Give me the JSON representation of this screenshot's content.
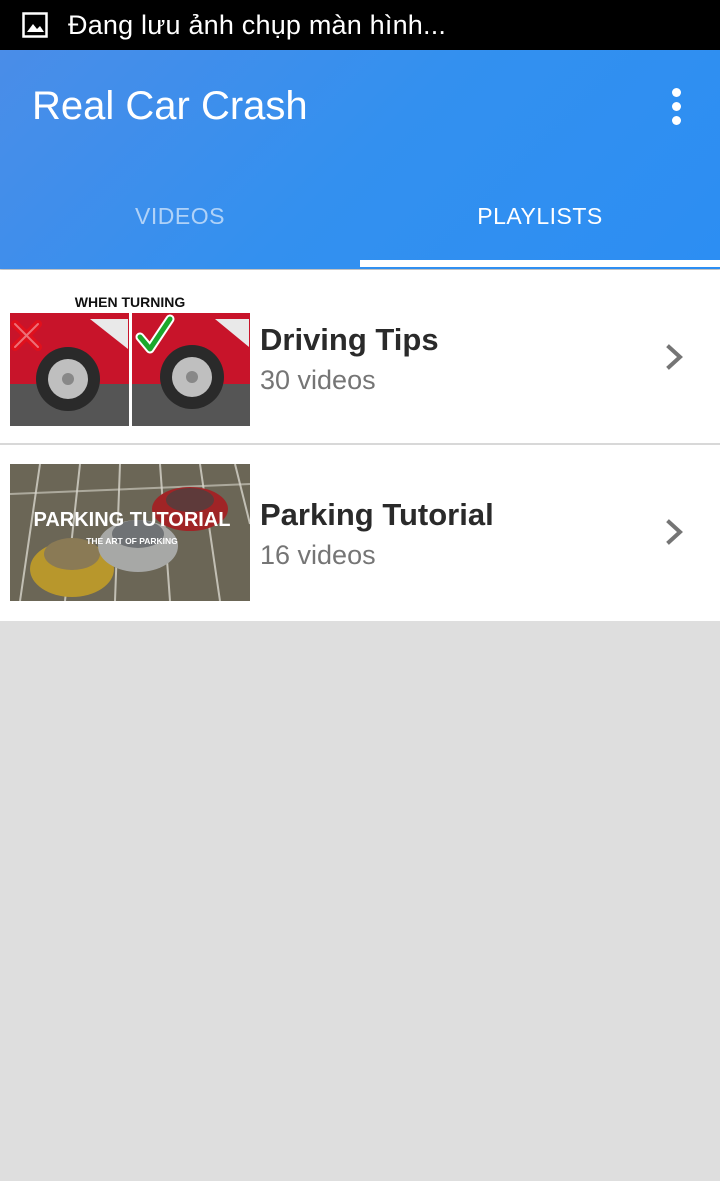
{
  "status_bar": {
    "icon": "image-icon",
    "text": "Đang lưu ảnh chụp màn hình..."
  },
  "app_bar": {
    "title": "Real Car Crash",
    "overflow_icon": "more-vert-icon",
    "background_color": "#3390ef"
  },
  "tabs": [
    {
      "label": "VIDEOS",
      "selected": false
    },
    {
      "label": "PLAYLISTS",
      "selected": true
    }
  ],
  "playlists": [
    {
      "title": "Driving Tips",
      "count": "30 videos",
      "thumbnail_text": "WHEN TURNING"
    },
    {
      "title": "Parking Tutorial",
      "count": "16 videos",
      "thumbnail_text": "PARKING TUTORIAL",
      "thumbnail_subtext": "THE ART OF PARKING"
    }
  ]
}
